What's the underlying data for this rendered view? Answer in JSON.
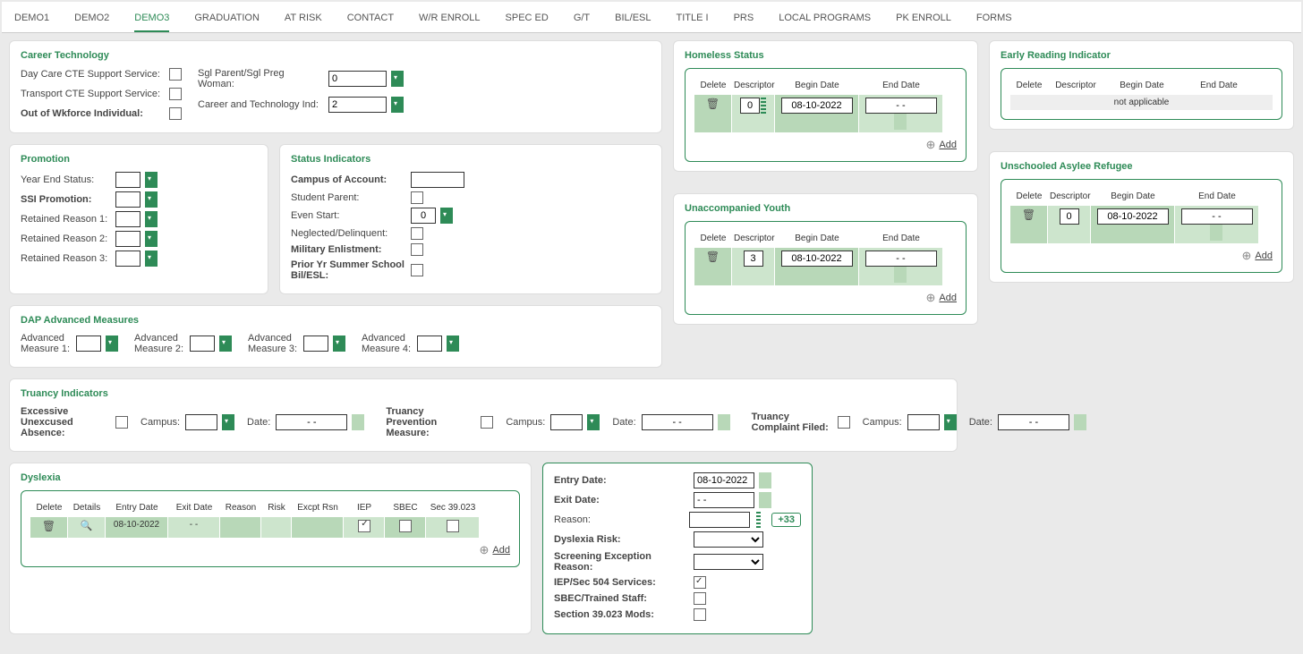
{
  "tabs": [
    "DEMO1",
    "DEMO2",
    "DEMO3",
    "GRADUATION",
    "AT RISK",
    "CONTACT",
    "W/R ENROLL",
    "SPEC ED",
    "G/T",
    "BIL/ESL",
    "TITLE I",
    "PRS",
    "LOCAL PROGRAMS",
    "PK ENROLL",
    "FORMS"
  ],
  "activeTab": 2,
  "careerTech": {
    "title": "Career Technology",
    "dayCare": "Day Care CTE Support Service:",
    "transport": "Transport CTE Support Service:",
    "outWk": "Out of Wkforce Individual:",
    "sglParent": "Sgl Parent/Sgl Preg Woman:",
    "ctInd": "Career and Technology Ind:",
    "sglVal": "0",
    "ctVal": "2"
  },
  "promotion": {
    "title": "Promotion",
    "yearEnd": "Year End Status:",
    "ssi": "SSI Promotion:",
    "ret1": "Retained Reason 1:",
    "ret2": "Retained Reason 2:",
    "ret3": "Retained Reason 3:"
  },
  "status": {
    "title": "Status Indicators",
    "campus": "Campus of Account:",
    "studParent": "Student Parent:",
    "even": "Even Start:",
    "evenVal": "0",
    "negl": "Neglected/Delinquent:",
    "mil": "Military Enlistment:",
    "prior": "Prior Yr Summer School Bil/ESL:"
  },
  "dap": {
    "title": "DAP Advanced Measures",
    "m1": "Advanced Measure 1:",
    "m2": "Advanced Measure 2:",
    "m3": "Advanced Measure 3:",
    "m4": "Advanced Measure 4:"
  },
  "homeless": {
    "title": "Homeless Status",
    "cols": [
      "Delete",
      "Descriptor",
      "Begin Date",
      "End Date"
    ],
    "descVal": "0",
    "begin": "08-10-2022",
    "end": "- -",
    "add": "Add"
  },
  "early": {
    "title": "Early Reading Indicator",
    "cols": [
      "Delete",
      "Descriptor",
      "Begin Date",
      "End Date"
    ],
    "na": "not applicable"
  },
  "uy": {
    "title": "Unaccompanied Youth",
    "cols": [
      "Delete",
      "Descriptor",
      "Begin Date",
      "End Date"
    ],
    "descVal": "3",
    "begin": "08-10-2022",
    "end": "- -",
    "add": "Add"
  },
  "uar": {
    "title": "Unschooled Asylee Refugee",
    "cols": [
      "Delete",
      "Descriptor",
      "Begin Date",
      "End Date"
    ],
    "descVal": "0",
    "begin": "08-10-2022",
    "end": "- -",
    "add": "Add"
  },
  "truancy": {
    "title": "Truancy Indicators",
    "exc": "Excessive Unexcused Absence:",
    "prev": "Truancy Prevention Measure:",
    "filed": "Truancy Complaint Filed:",
    "campus": "Campus:",
    "date": "Date:",
    "dateVal": "- -"
  },
  "dys": {
    "title": "Dyslexia",
    "cols": [
      "Delete",
      "Details",
      "Entry Date",
      "Exit Date",
      "Reason",
      "Risk",
      "Excpt Rsn",
      "IEP",
      "SBEC",
      "Sec 39.023"
    ],
    "entry": "08-10-2022",
    "exit": "- -",
    "add": "Add"
  },
  "detail": {
    "entry": "Entry Date:",
    "entryVal": "08-10-2022",
    "exit": "Exit Date:",
    "exitVal": "- -",
    "reason": "Reason:",
    "plus": "+33",
    "risk": "Dyslexia Risk:",
    "scrn": "Screening Exception Reason:",
    "iep": "IEP/Sec 504 Services:",
    "sbec": "SBEC/Trained Staff:",
    "mods": "Section 39.023 Mods:"
  }
}
